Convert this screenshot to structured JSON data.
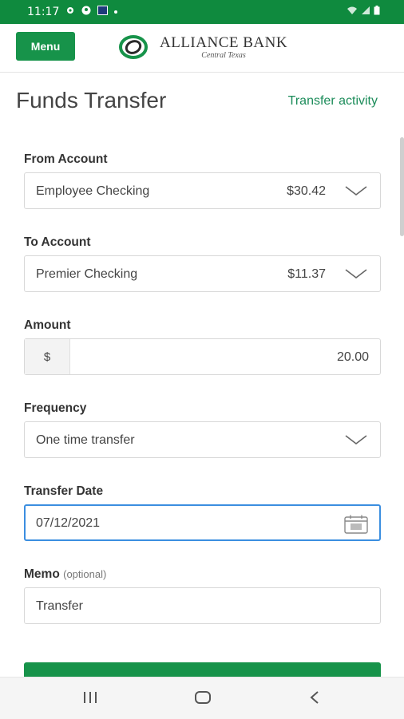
{
  "status_bar": {
    "time": "11:17",
    "left_icons": [
      "gear-icon",
      "account-circle-icon",
      "image-icon",
      "dot-icon"
    ],
    "right_icons": [
      "wifi-icon",
      "signal-icon",
      "battery-icon"
    ]
  },
  "header": {
    "menu_label": "Menu",
    "brand_name": "ALLIANCE BANK",
    "brand_sub": "Central Texas",
    "brand_color": "#17934a"
  },
  "page": {
    "title": "Funds Transfer",
    "activity_link": "Transfer activity"
  },
  "form": {
    "from": {
      "label": "From Account",
      "account": "Employee Checking",
      "balance": "$30.42"
    },
    "to": {
      "label": "To Account",
      "account": "Premier Checking",
      "balance": "$11.37"
    },
    "amount": {
      "label": "Amount",
      "prefix": "$",
      "value": "20.00"
    },
    "frequency": {
      "label": "Frequency",
      "value": "One time transfer"
    },
    "date": {
      "label": "Transfer Date",
      "value": "07/12/2021"
    },
    "memo": {
      "label": "Memo",
      "optional": "(optional)",
      "value": "Transfer"
    }
  },
  "nav": {
    "icons": [
      "recent-apps-icon",
      "home-icon",
      "back-icon"
    ]
  }
}
